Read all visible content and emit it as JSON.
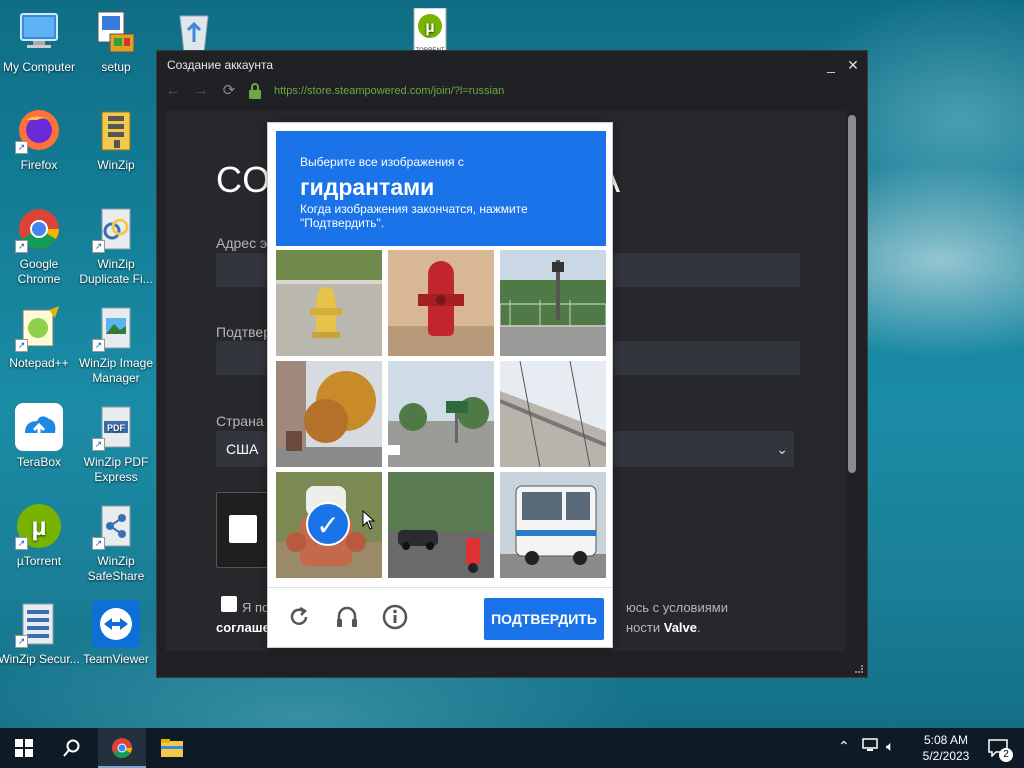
{
  "desktop": {
    "icons": [
      {
        "label": "My Computer"
      },
      {
        "label": "setup"
      },
      {
        "label": ""
      },
      {
        "label": ""
      },
      {
        "label": "Firefox"
      },
      {
        "label": "WinZip"
      },
      {
        "label": "Google Chrome"
      },
      {
        "label": "WinZip Duplicate Fi..."
      },
      {
        "label": "Notepad++"
      },
      {
        "label": "WinZip Image Manager"
      },
      {
        "label": "TeraBox"
      },
      {
        "label": "WinZip PDF Express"
      },
      {
        "label": "µTorrent"
      },
      {
        "label": "WinZip SafeShare"
      },
      {
        "label": "WinZip Secur..."
      },
      {
        "label": "TeamViewer"
      }
    ],
    "utorrent_badge_text": "TORRENT"
  },
  "window": {
    "title": "Создание аккаунта",
    "url": "https://store.steampowered.com/join/?l=russian"
  },
  "steam_page": {
    "heading_left": "СО",
    "heading_right": "А",
    "email_label": "Адрес э",
    "confirm_label": "Подтвер",
    "country_label": "Страна",
    "country_value": "США",
    "agree_text_start": "Я по",
    "agree_text_end": "юсь с условиями",
    "agree_line2_start": "соглаше",
    "agree_line2_end_plain": "ности ",
    "agree_line2_end_bold": "Valve",
    "agree_line2_end_dot": "."
  },
  "captcha": {
    "instruction_line1": "Выберите все изображения с",
    "target_word": "гидрантами",
    "instruction_line2": "Когда изображения закончатся, нажмите \"Подтвердить\".",
    "verify_label": "ПОДТВЕРДИТЬ",
    "tiles": [
      {
        "subject": "yellow fire hydrant on sidewalk",
        "selected": false
      },
      {
        "subject": "red fire hydrant",
        "selected": false
      },
      {
        "subject": "street with fence and trees",
        "selected": false
      },
      {
        "subject": "autumn trees and buildings",
        "selected": false
      },
      {
        "subject": "street intersection with sign",
        "selected": false
      },
      {
        "subject": "overpass structure",
        "selected": false
      },
      {
        "subject": "red and white fire hydrant",
        "selected": true
      },
      {
        "subject": "road with cars and scooter",
        "selected": false
      },
      {
        "subject": "white bus",
        "selected": false
      }
    ],
    "icons": [
      "reload-icon",
      "audio-icon",
      "info-icon"
    ]
  },
  "taskbar": {
    "time": "5:08 AM",
    "date": "5/2/2023",
    "notification_count": "2"
  },
  "colors": {
    "captcha_blue": "#1a73e8",
    "window_bg": "#1f2125",
    "url_green": "#6fa843",
    "taskbar": "#0e1b26"
  }
}
